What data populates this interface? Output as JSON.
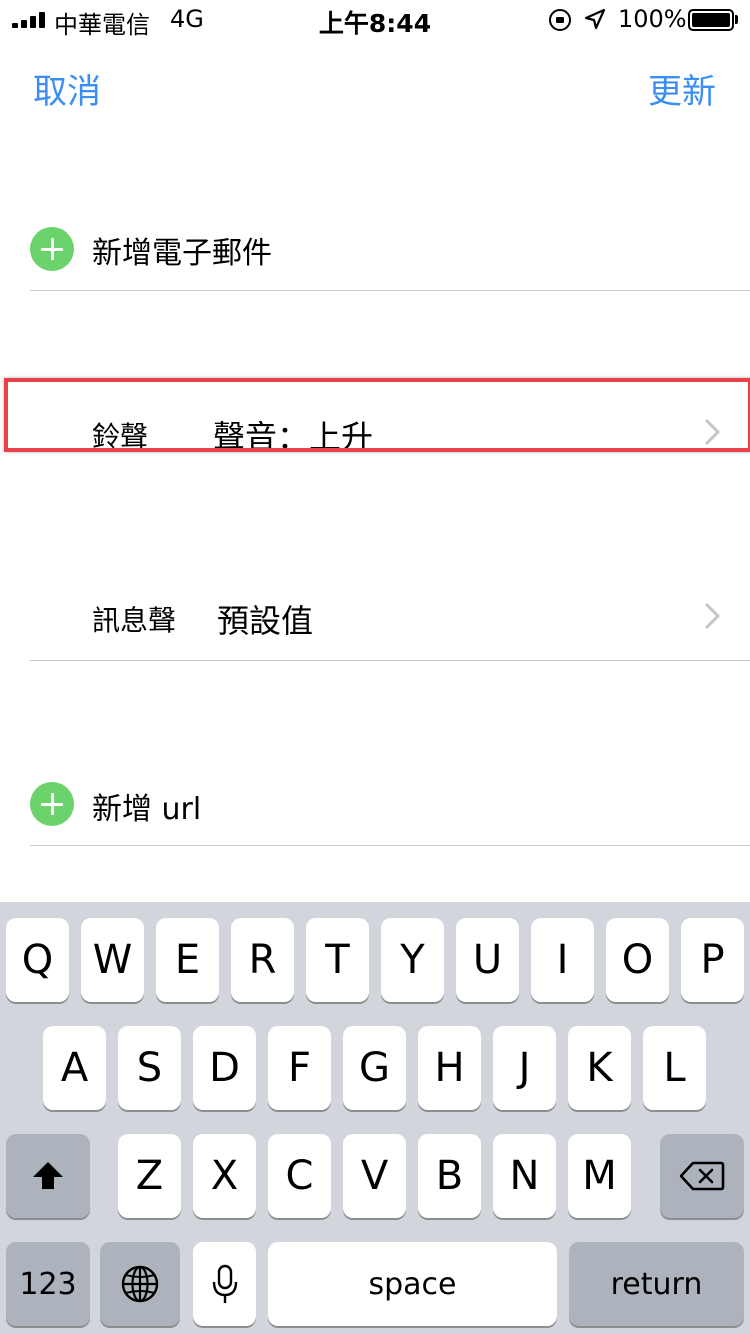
{
  "status_bar": {
    "carrier": "中華電信",
    "network": "4G",
    "time": "上午8:44",
    "battery_percent": "100%"
  },
  "nav": {
    "cancel_label": "取消",
    "update_label": "更新"
  },
  "form": {
    "add_email_label": "新增電子郵件",
    "ringtone": {
      "label": "鈴聲",
      "value": "聲音：上升"
    },
    "text_tone": {
      "label": "訊息聲",
      "value": "預設值"
    },
    "add_url_label": "新增 url"
  },
  "keyboard": {
    "row1": [
      "Q",
      "W",
      "E",
      "R",
      "T",
      "Y",
      "U",
      "I",
      "O",
      "P"
    ],
    "row2": [
      "A",
      "S",
      "D",
      "F",
      "G",
      "H",
      "J",
      "K",
      "L"
    ],
    "row3": [
      "Z",
      "X",
      "C",
      "V",
      "B",
      "N",
      "M"
    ],
    "numbers_label": "123",
    "space_label": "space",
    "return_label": "return"
  },
  "icons": [
    "signal-icon",
    "orientation-lock-icon",
    "location-arrow-icon",
    "battery-icon",
    "add-icon",
    "chevron-right-icon",
    "shift-icon",
    "delete-icon",
    "globe-icon",
    "microphone-icon"
  ],
  "colors": {
    "accent": "#3a8ef6",
    "add_green": "#6cd36c",
    "highlight_red": "#e8434b",
    "keyboard_bg": "#d2d5db"
  }
}
